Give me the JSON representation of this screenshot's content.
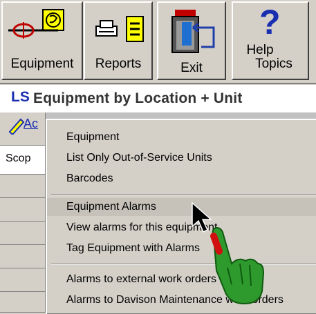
{
  "toolbar": {
    "equipment_label": "Equipment",
    "reports_label": "Reports",
    "exit_label": "Exit",
    "help_label_line1": "Help",
    "help_label_line2": "Topics"
  },
  "window": {
    "title": "Equipment by Location + Unit",
    "icon_text": "LS"
  },
  "grid": {
    "header_fragment": "Ac",
    "first_cell_fragment": "Scop"
  },
  "context_menu": {
    "items": [
      {
        "label": "Equipment"
      },
      {
        "label": "List Only Out-of-Service Units"
      },
      {
        "label": "Barcodes"
      },
      {
        "label": "Equipment Alarms"
      },
      {
        "label": "View alarms for this equipment"
      },
      {
        "label": "Tag Equipment with Alarms"
      },
      {
        "label": "Alarms to external work orders"
      },
      {
        "label": "Alarms to Davison Maintenance work orders"
      }
    ]
  },
  "colors": {
    "face": "#d4d0c8",
    "highlight": "#c6c2ba",
    "hand": "#2e9a2e"
  }
}
